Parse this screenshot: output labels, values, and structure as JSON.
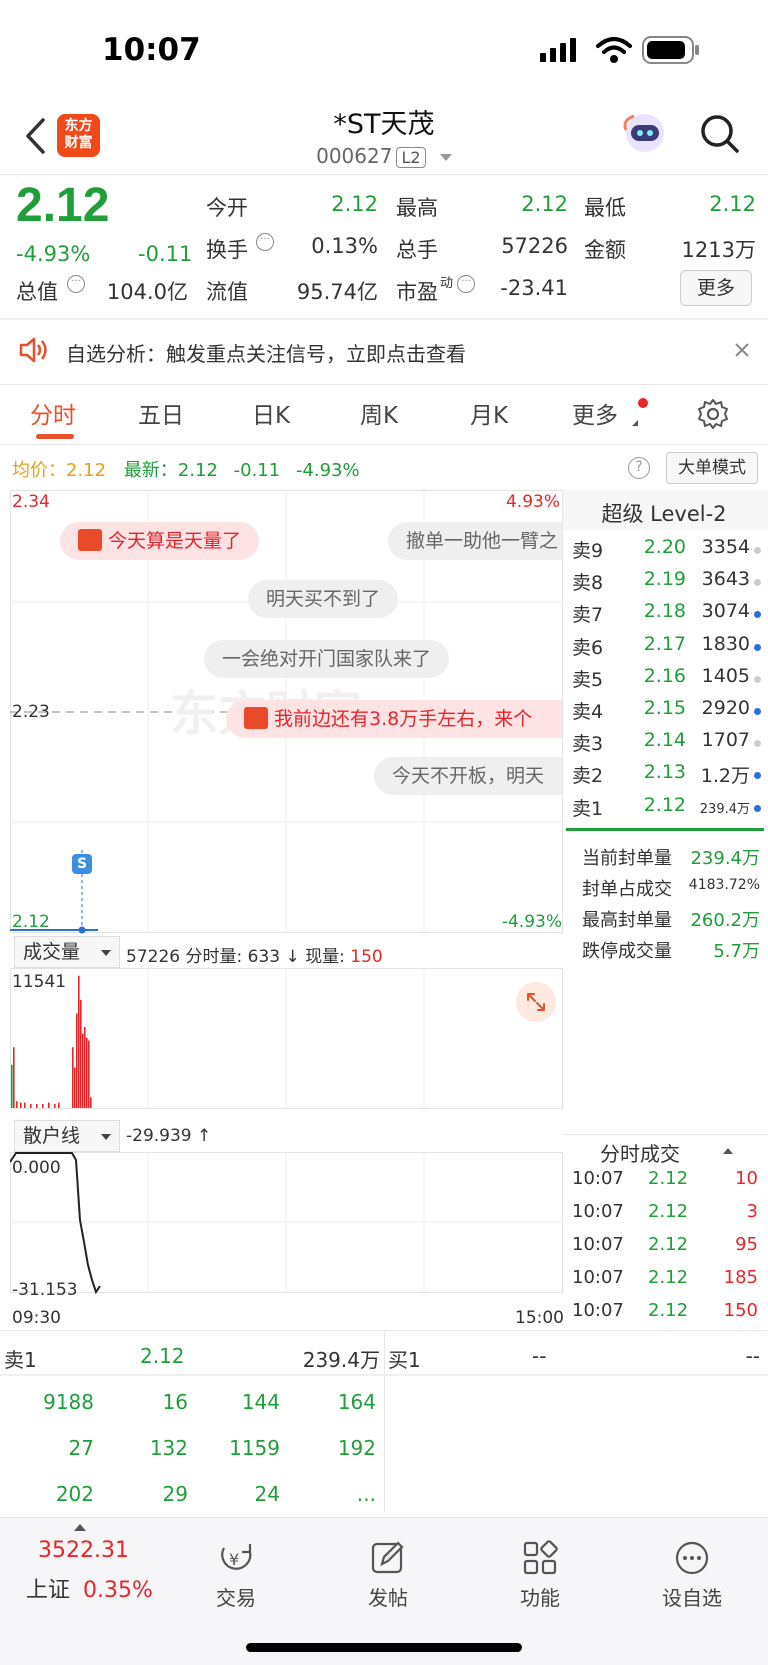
{
  "status_bar": {
    "time": "10:07"
  },
  "header": {
    "logo_line1": "东方",
    "logo_line2": "财富",
    "name": "*ST天茂",
    "code": "000627",
    "level_badge": "L2"
  },
  "quote": {
    "price": "2.12",
    "change_pct": "-4.93%",
    "change": "-0.11",
    "fields": [
      {
        "label": "今开",
        "value": "2.12"
      },
      {
        "label": "最高",
        "value": "2.12"
      },
      {
        "label": "最低",
        "value": "2.12"
      },
      {
        "label": "换手",
        "value": "0.13%"
      },
      {
        "label": "总手",
        "value": "57226"
      },
      {
        "label": "金额",
        "value": "1213万"
      },
      {
        "label": "总值",
        "value": "104.0亿"
      },
      {
        "label": "流值",
        "value": "95.74亿"
      },
      {
        "label": "市盈",
        "value": "-23.41"
      }
    ],
    "pe_superscript": "动",
    "more_label": "更多"
  },
  "banner": {
    "text": "自选分析：触发重点关注信号，立即点击查看"
  },
  "tabs": [
    {
      "label": "分时"
    },
    {
      "label": "五日"
    },
    {
      "label": "日K"
    },
    {
      "label": "周K"
    },
    {
      "label": "月K"
    },
    {
      "label": "更多"
    }
  ],
  "avg_row": {
    "avg_label": "均价：",
    "avg_value": "2.12",
    "latest_label": "最新：",
    "latest_value": "2.12",
    "latest_change": "-0.11",
    "latest_pct": "-4.93%",
    "mode_button": "大单模式"
  },
  "chart": {
    "price_top": "2.34",
    "price_mid": "2.23",
    "price_bottom": "2.12",
    "pct_top": "4.93%",
    "pct_bottom": "-4.93%",
    "marker": "S",
    "comments": [
      {
        "text": "今天算是天量了"
      },
      {
        "text": "撤单一助他一臂之"
      },
      {
        "text": "明天买不到了"
      },
      {
        "text": "一会绝对开门国家队来了"
      },
      {
        "text": "我前边还有3.8万手左右，来个"
      },
      {
        "text": "今天不开板，明天"
      }
    ]
  },
  "volume": {
    "selector": "成交量",
    "summary_total": "57226",
    "summary_minute_label": "分时量:",
    "summary_minute": "633",
    "summary_arrow": "↓",
    "summary_now_label": "现量:",
    "summary_now": "150",
    "max_label": "11541"
  },
  "retail": {
    "selector": "散户线",
    "value": "-29.939",
    "arrow": "↑",
    "top_label": "0.000",
    "bottom_label": "-31.153",
    "time_start": "09:30",
    "time_end": "15:00"
  },
  "level2": {
    "title": "超级 Level-2",
    "asks": [
      {
        "label": "卖9",
        "price": "2.20",
        "vol": "3354",
        "dot": "#cccccc"
      },
      {
        "label": "卖8",
        "price": "2.19",
        "vol": "3643",
        "dot": "#cccccc"
      },
      {
        "label": "卖7",
        "price": "2.18",
        "vol": "3074",
        "dot": "#2c6fd6"
      },
      {
        "label": "卖6",
        "price": "2.17",
        "vol": "1830",
        "dot": "#2c6fd6"
      },
      {
        "label": "卖5",
        "price": "2.16",
        "vol": "1405",
        "dot": "#cccccc"
      },
      {
        "label": "卖4",
        "price": "2.15",
        "vol": "2920",
        "dot": "#2c6fd6"
      },
      {
        "label": "卖3",
        "price": "2.14",
        "vol": "1707",
        "dot": "#cccccc"
      },
      {
        "label": "卖2",
        "price": "2.13",
        "vol": "1.2万",
        "dot": "#2c6fd6"
      },
      {
        "label": "卖1",
        "price": "2.12",
        "vol": "239.4万",
        "dot": "#2c6fd6"
      }
    ],
    "seal": [
      {
        "label": "当前封单量",
        "value": "239.4万"
      },
      {
        "label": "封单占成交",
        "value": "4183.72%"
      },
      {
        "label": "最高封单量",
        "value": "260.2万"
      },
      {
        "label": "跌停成交量",
        "value": "5.7万"
      }
    ],
    "ticks_title": "分时成交",
    "ticks": [
      {
        "time": "10:07",
        "price": "2.12",
        "vol": "10"
      },
      {
        "time": "10:07",
        "price": "2.12",
        "vol": "3"
      },
      {
        "time": "10:07",
        "price": "2.12",
        "vol": "95"
      },
      {
        "time": "10:07",
        "price": "2.12",
        "vol": "185"
      },
      {
        "time": "10:07",
        "price": "2.12",
        "vol": "150"
      }
    ]
  },
  "order_grid": {
    "sell_label": "卖1",
    "sell_price": "2.12",
    "sell_vol": "239.4万",
    "buy_label": "买1",
    "buy_price": "--",
    "buy_vol": "--",
    "queue": [
      [
        "9188",
        "16",
        "144",
        "164"
      ],
      [
        "27",
        "132",
        "1159",
        "192"
      ],
      [
        "202",
        "29",
        "24",
        "..."
      ]
    ]
  },
  "bottom_nav": {
    "index_value": "3522.31",
    "index_name": "上证",
    "index_pct": "0.35%",
    "items": [
      {
        "label": "交易"
      },
      {
        "label": "发帖"
      },
      {
        "label": "功能"
      },
      {
        "label": "设自选"
      }
    ]
  }
}
